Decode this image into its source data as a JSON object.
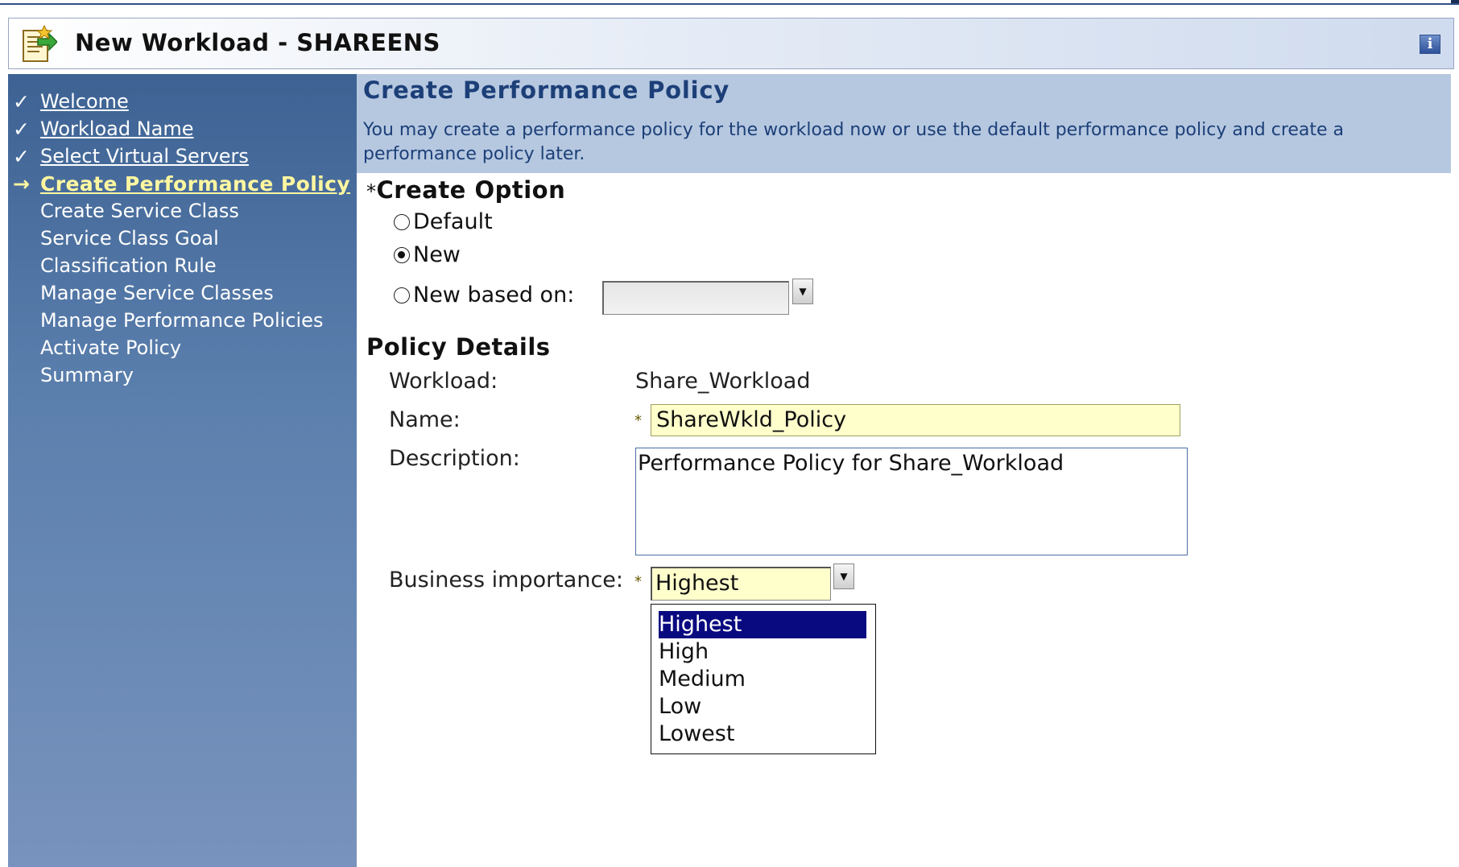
{
  "window": {
    "title": "New Workload - SHAREENS",
    "icon": "wizard-icon",
    "info_icon": "info-icon",
    "info_glyph": "i"
  },
  "colors": {
    "sidebar_top": "#3d6293",
    "sidebar_bottom": "#7893bd",
    "header_band": "#b6c8e0",
    "current_step": "#fff7a0",
    "required_field": "#ffffcc",
    "list_selection": "#0a0a80"
  },
  "sidebar": {
    "items": [
      {
        "label": "Welcome",
        "state": "done",
        "mark": "✓"
      },
      {
        "label": "Workload Name",
        "state": "done",
        "mark": "✓"
      },
      {
        "label": "Select Virtual Servers",
        "state": "done",
        "mark": "✓"
      },
      {
        "label": "Create Performance Policy",
        "state": "current",
        "mark": "→"
      },
      {
        "label": "Create Service Class",
        "state": "pending",
        "mark": ""
      },
      {
        "label": "Service Class Goal",
        "state": "pending",
        "mark": ""
      },
      {
        "label": "Classification Rule",
        "state": "pending",
        "mark": ""
      },
      {
        "label": "Manage Service Classes",
        "state": "pending",
        "mark": ""
      },
      {
        "label": "Manage Performance Policies",
        "state": "pending",
        "mark": ""
      },
      {
        "label": "Activate Policy",
        "state": "pending",
        "mark": ""
      },
      {
        "label": "Summary",
        "state": "pending",
        "mark": ""
      }
    ]
  },
  "main": {
    "title": "Create Performance Policy",
    "description": "You may create a performance policy for the workload now or use the default performance policy and create a performance policy later.",
    "create_option": {
      "required_mark": "*",
      "heading": "Create Option",
      "options": [
        {
          "label": "Default",
          "checked": false
        },
        {
          "label": "New",
          "checked": true
        },
        {
          "label": "New based on:",
          "checked": false
        }
      ],
      "based_on_value": ""
    },
    "policy_details": {
      "heading": "Policy Details",
      "workload_label": "Workload:",
      "workload_value": "Share_Workload",
      "name_label": "Name:",
      "name_value": "ShareWkld_Policy",
      "description_label": "Description:",
      "description_value": "Performance Policy for Share_Workload",
      "business_importance_label": "Business importance:",
      "business_importance_value": "Highest",
      "required_mark": "*",
      "business_importance_options": [
        "Highest",
        "High",
        "Medium",
        "Low",
        "Lowest"
      ],
      "business_importance_selected": "Highest"
    }
  }
}
